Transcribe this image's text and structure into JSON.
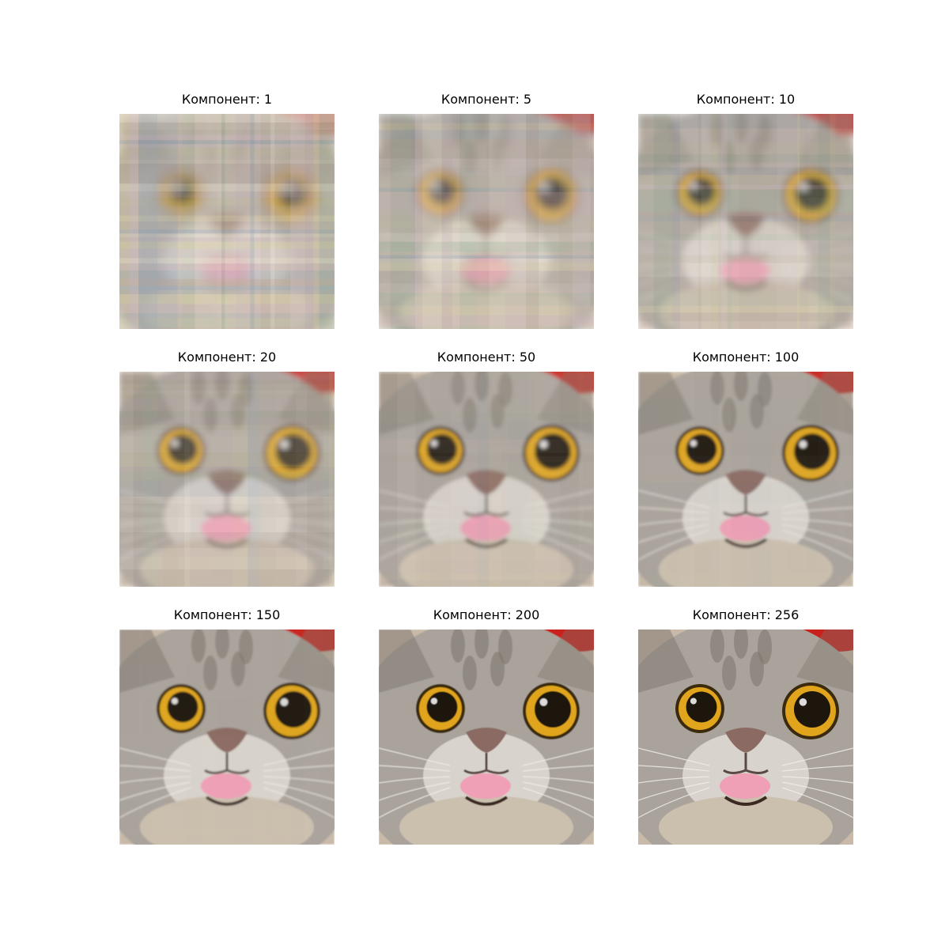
{
  "figure": {
    "panels": [
      {
        "title": "Компонент: 1",
        "components": 1
      },
      {
        "title": "Компонент: 5",
        "components": 5
      },
      {
        "title": "Компонент: 10",
        "components": 10
      },
      {
        "title": "Компонент: 20",
        "components": 20
      },
      {
        "title": "Компонент: 50",
        "components": 50
      },
      {
        "title": "Компонент: 100",
        "components": 100
      },
      {
        "title": "Компонент: 150",
        "components": 150
      },
      {
        "title": "Компонент: 200",
        "components": 200
      },
      {
        "title": "Компонент: 256",
        "components": 256
      }
    ]
  },
  "colors": {
    "fur": "#a9a39c",
    "fur_dark": "#7c756c",
    "fur_light": "#d8d3cc",
    "eye_iris": "#e0a51a",
    "eye_pupil": "#1c1208",
    "nose": "#8a6a62",
    "tongue": "#ef9fb6",
    "hat_red": "#c9201a",
    "background": "#ffffff"
  },
  "icons": {
    "image": "cat-face-image"
  }
}
